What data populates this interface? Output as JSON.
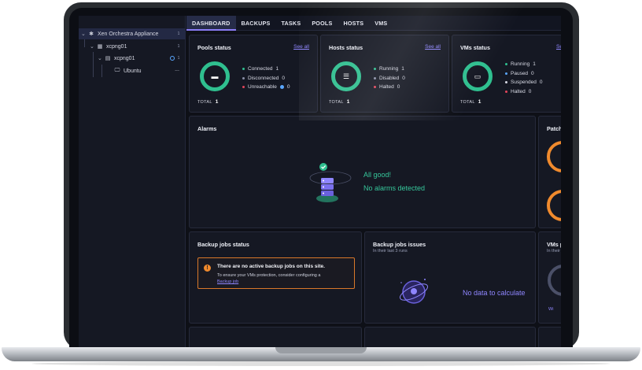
{
  "tabs": [
    {
      "label": "DASHBOARD",
      "active": true
    },
    {
      "label": "BACKUPS"
    },
    {
      "label": "TASKS"
    },
    {
      "label": "POOLS"
    },
    {
      "label": "HOSTS"
    },
    {
      "label": "VMS"
    }
  ],
  "sidebar": {
    "items": [
      {
        "label": "Xen Orchestra Appliance",
        "icon": "xo-logo-icon",
        "count": "1"
      },
      {
        "label": "xcpng01",
        "icon": "pool-icon",
        "count": "1"
      },
      {
        "label": "xcpng01",
        "icon": "host-icon",
        "count": "1"
      },
      {
        "label": "Ubuntu",
        "icon": "vm-icon",
        "more": "..."
      }
    ]
  },
  "pools": {
    "title": "Pools status",
    "see_all": "See all",
    "legend": [
      {
        "label": "Connected",
        "value": "1",
        "color": "#2fbf8f"
      },
      {
        "label": "Disconnected",
        "value": "0",
        "color": "#8a8fa6"
      },
      {
        "label": "Unreachable",
        "value": "0",
        "color": "#e2455a"
      }
    ],
    "total_label": "TOTAL",
    "total": "1"
  },
  "hosts": {
    "title": "Hosts status",
    "see_all": "See all",
    "legend": [
      {
        "label": "Running",
        "value": "1",
        "color": "#2fbf8f"
      },
      {
        "label": "Disabled",
        "value": "0",
        "color": "#8a8fa6"
      },
      {
        "label": "Halted",
        "value": "0",
        "color": "#e2455a"
      }
    ],
    "total_label": "TOTAL",
    "total": "1"
  },
  "vms": {
    "title": "VMs status",
    "see_all": "Se",
    "legend": [
      {
        "label": "Running",
        "value": "1",
        "color": "#2fbf8f"
      },
      {
        "label": "Paused",
        "value": "0",
        "color": "#5aa7ff"
      },
      {
        "label": "Suspended",
        "value": "0",
        "color": "#d7d9e4"
      },
      {
        "label": "Halted",
        "value": "0",
        "color": "#e2455a"
      }
    ],
    "total_label": "TOTAL",
    "total": "1"
  },
  "alarms": {
    "title": "Alarms",
    "ok_line1": "All good!",
    "ok_line2": "No alarms detected"
  },
  "patches": {
    "title": "Patch"
  },
  "backup_status": {
    "title": "Backup jobs status",
    "notice_title": "There are no active backup jobs on this site.",
    "notice_body": "To ensure your VMs protection, consider configuring a",
    "notice_link": "Backup job"
  },
  "backup_issues": {
    "title": "Backup jobs issues",
    "subtitle": "In their last 3 runs",
    "empty": "No data to calculate"
  },
  "vms_protection": {
    "title": "VMs p",
    "subtitle": "In their",
    "legend": "Wi"
  },
  "colors": {
    "accent": "#8f86ff",
    "success": "#2fbf8f",
    "warning": "#f08a2d",
    "danger": "#e2455a"
  }
}
